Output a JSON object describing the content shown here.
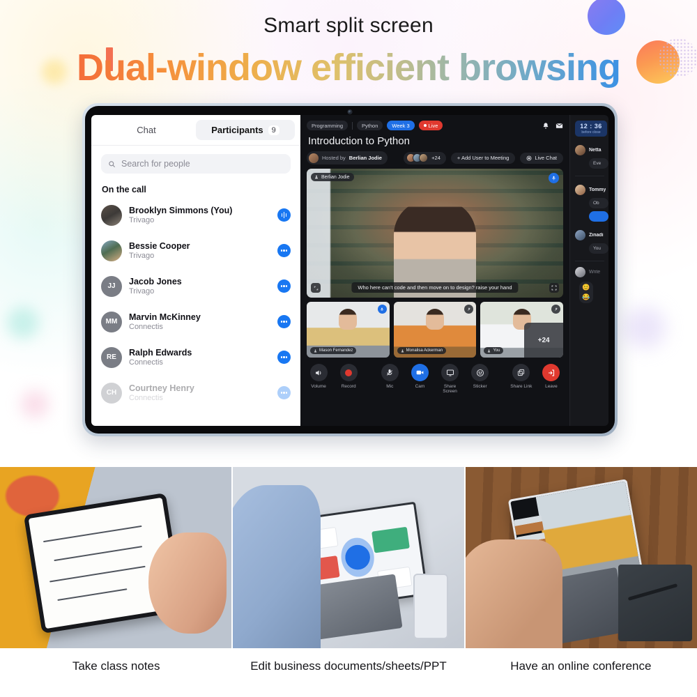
{
  "hero": {
    "kicker": "Smart split screen",
    "headline": "Dual-window efficient browsing",
    "accent_start": "#ef5838",
    "accent_end": "#2f7fe0"
  },
  "left_panel": {
    "tabs": [
      {
        "label": "Chat",
        "active": false
      },
      {
        "label": "Participants",
        "active": true,
        "count": "9"
      }
    ],
    "search": {
      "placeholder": "Search for people",
      "value": "",
      "icon": "search-icon"
    },
    "section_title": "On the call",
    "people": [
      {
        "name": "Brooklyn Simmons (You)",
        "org": "Trivago",
        "initials": "",
        "action": "audio-level-icon"
      },
      {
        "name": "Bessie Cooper",
        "org": "Trivago",
        "initials": "",
        "action": "more-icon"
      },
      {
        "name": "Jacob Jones",
        "org": "Trivago",
        "initials": "JJ",
        "action": "more-icon"
      },
      {
        "name": "Marvin McKinney",
        "org": "Connectis",
        "initials": "MM",
        "action": "more-icon"
      },
      {
        "name": "Ralph Edwards",
        "org": "Connectis",
        "initials": "RE",
        "action": "more-icon"
      },
      {
        "name": "Courtney Henry",
        "org": "Connectis",
        "initials": "CH",
        "action": "more-icon"
      }
    ]
  },
  "meeting": {
    "chips": [
      {
        "label": "Programming",
        "style": "default"
      },
      {
        "label": "Python",
        "style": "default"
      },
      {
        "label": "Week 3",
        "style": "blue"
      },
      {
        "label": "Live",
        "style": "red"
      }
    ],
    "header_icons": [
      "bell-icon",
      "mail-icon"
    ],
    "title": "Introduction to Python",
    "host_prefix": "Hosted by",
    "host_name": "Berlian Jodie",
    "attendees_more": "+24",
    "add_user_label": "+ Add User to Meeting",
    "live_chat_label": "Live Chat",
    "stage": {
      "speaker_name": "Berlian Jodie",
      "caption": "Who here can't code and then move on to design? raise your hand",
      "mic_icon": "mic-on-icon",
      "expand_icon": "expand-icon",
      "fullscreen_icon": "fullscreen-icon"
    },
    "thumbnails": [
      {
        "name": "Mason Fernandez",
        "badge": "mic-on-icon",
        "mic_on": true
      },
      {
        "name": "Monalisa Ackerman",
        "badge": "mic-off-icon",
        "mic_on": false
      },
      {
        "name": "You",
        "badge": "mic-off-icon",
        "mic_on": false,
        "more": "+24"
      }
    ],
    "toolbar": [
      {
        "label": "Volume",
        "icon": "volume-icon",
        "style": "default"
      },
      {
        "label": "Record",
        "icon": "record-icon",
        "style": "record"
      },
      {
        "label": "Mic",
        "icon": "mic-off-icon",
        "style": "default"
      },
      {
        "label": "Cam",
        "icon": "camera-icon",
        "style": "blue"
      },
      {
        "label": "Share Screen",
        "icon": "screen-icon",
        "style": "default"
      },
      {
        "label": "Sticker",
        "icon": "sticker-icon",
        "style": "default"
      },
      {
        "label": "Share Link",
        "icon": "copy-icon",
        "style": "default"
      },
      {
        "label": "Leave",
        "icon": "leave-icon",
        "style": "red"
      }
    ]
  },
  "right_panel": {
    "timer_time": "12 : 36",
    "timer_sub": "before close",
    "messages": [
      {
        "name": "Netta",
        "text": "Eve"
      },
      {
        "name": "Tommy",
        "text": "Ob"
      },
      {
        "name": "Zinadi",
        "text": "You"
      }
    ],
    "input_placeholder": "Write",
    "emojis": [
      "😊",
      "😂"
    ]
  },
  "gallery": {
    "captions": [
      "Take class notes",
      "Edit business documents/sheets/PPT",
      "Have an online conference"
    ]
  }
}
